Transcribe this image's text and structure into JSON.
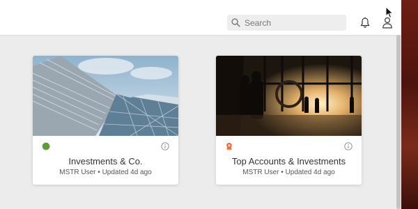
{
  "header": {
    "search_placeholder": "Search",
    "icons": [
      "search-icon",
      "bell-icon",
      "user-icon"
    ]
  },
  "dossiers": [
    {
      "title": "Investments & Co.",
      "owner": "MSTR User",
      "separator": "•",
      "updated": "Updated 4d ago",
      "badge": "green-status-dot",
      "badge_color": "#5aa02c"
    },
    {
      "title": "Top Accounts & Investments",
      "owner": "MSTR User",
      "separator": "•",
      "updated": "Updated 4d ago",
      "badge": "certified-ribbon-icon",
      "badge_color": "#e86a2c"
    }
  ],
  "colors": {
    "background": "#ececec",
    "topbar": "#ffffff",
    "card": "#ffffff",
    "desktop_edge": "#6e1f14"
  }
}
